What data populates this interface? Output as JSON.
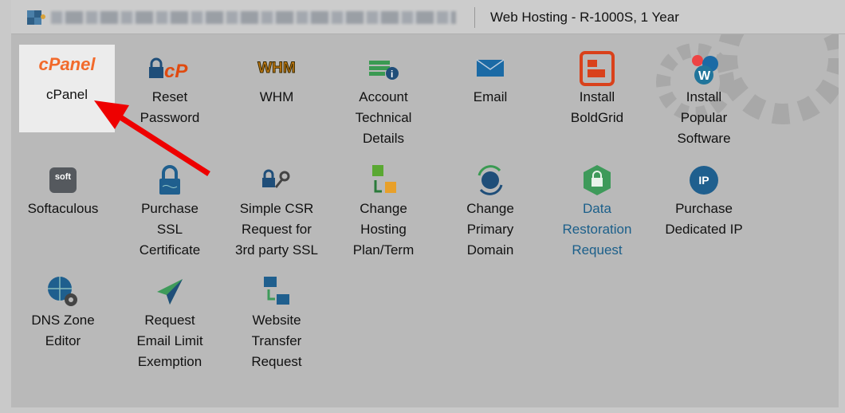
{
  "header": {
    "plan": "Web Hosting - R-1000S, 1 Year"
  },
  "tiles": [
    {
      "label": "cPanel",
      "logo": "cPanel"
    },
    {
      "label": "Reset\nPassword"
    },
    {
      "label": "WHM",
      "logo": "WHM"
    },
    {
      "label": "Account\nTechnical\nDetails"
    },
    {
      "label": "Email"
    },
    {
      "label": "Install\nBoldGrid"
    },
    {
      "label": "Install\nPopular\nSoftware"
    },
    {
      "label": "Softaculous",
      "logo": "soft"
    },
    {
      "label": "Purchase\nSSL\nCertificate"
    },
    {
      "label": "Simple CSR\nRequest for\n3rd party SSL"
    },
    {
      "label": "Change\nHosting\nPlan/Term"
    },
    {
      "label": "Change\nPrimary\nDomain"
    },
    {
      "label": "Data\nRestoration\nRequest"
    },
    {
      "label": "Purchase\nDedicated IP",
      "logo": "IP"
    },
    {
      "label": "DNS Zone\nEditor"
    },
    {
      "label": "Request\nEmail Limit\nExemption"
    },
    {
      "label": "Website\nTransfer\nRequest"
    }
  ],
  "colors": {
    "accent": "#e8551c",
    "link": "#1b5f8a",
    "arrow": "#ee0000"
  }
}
